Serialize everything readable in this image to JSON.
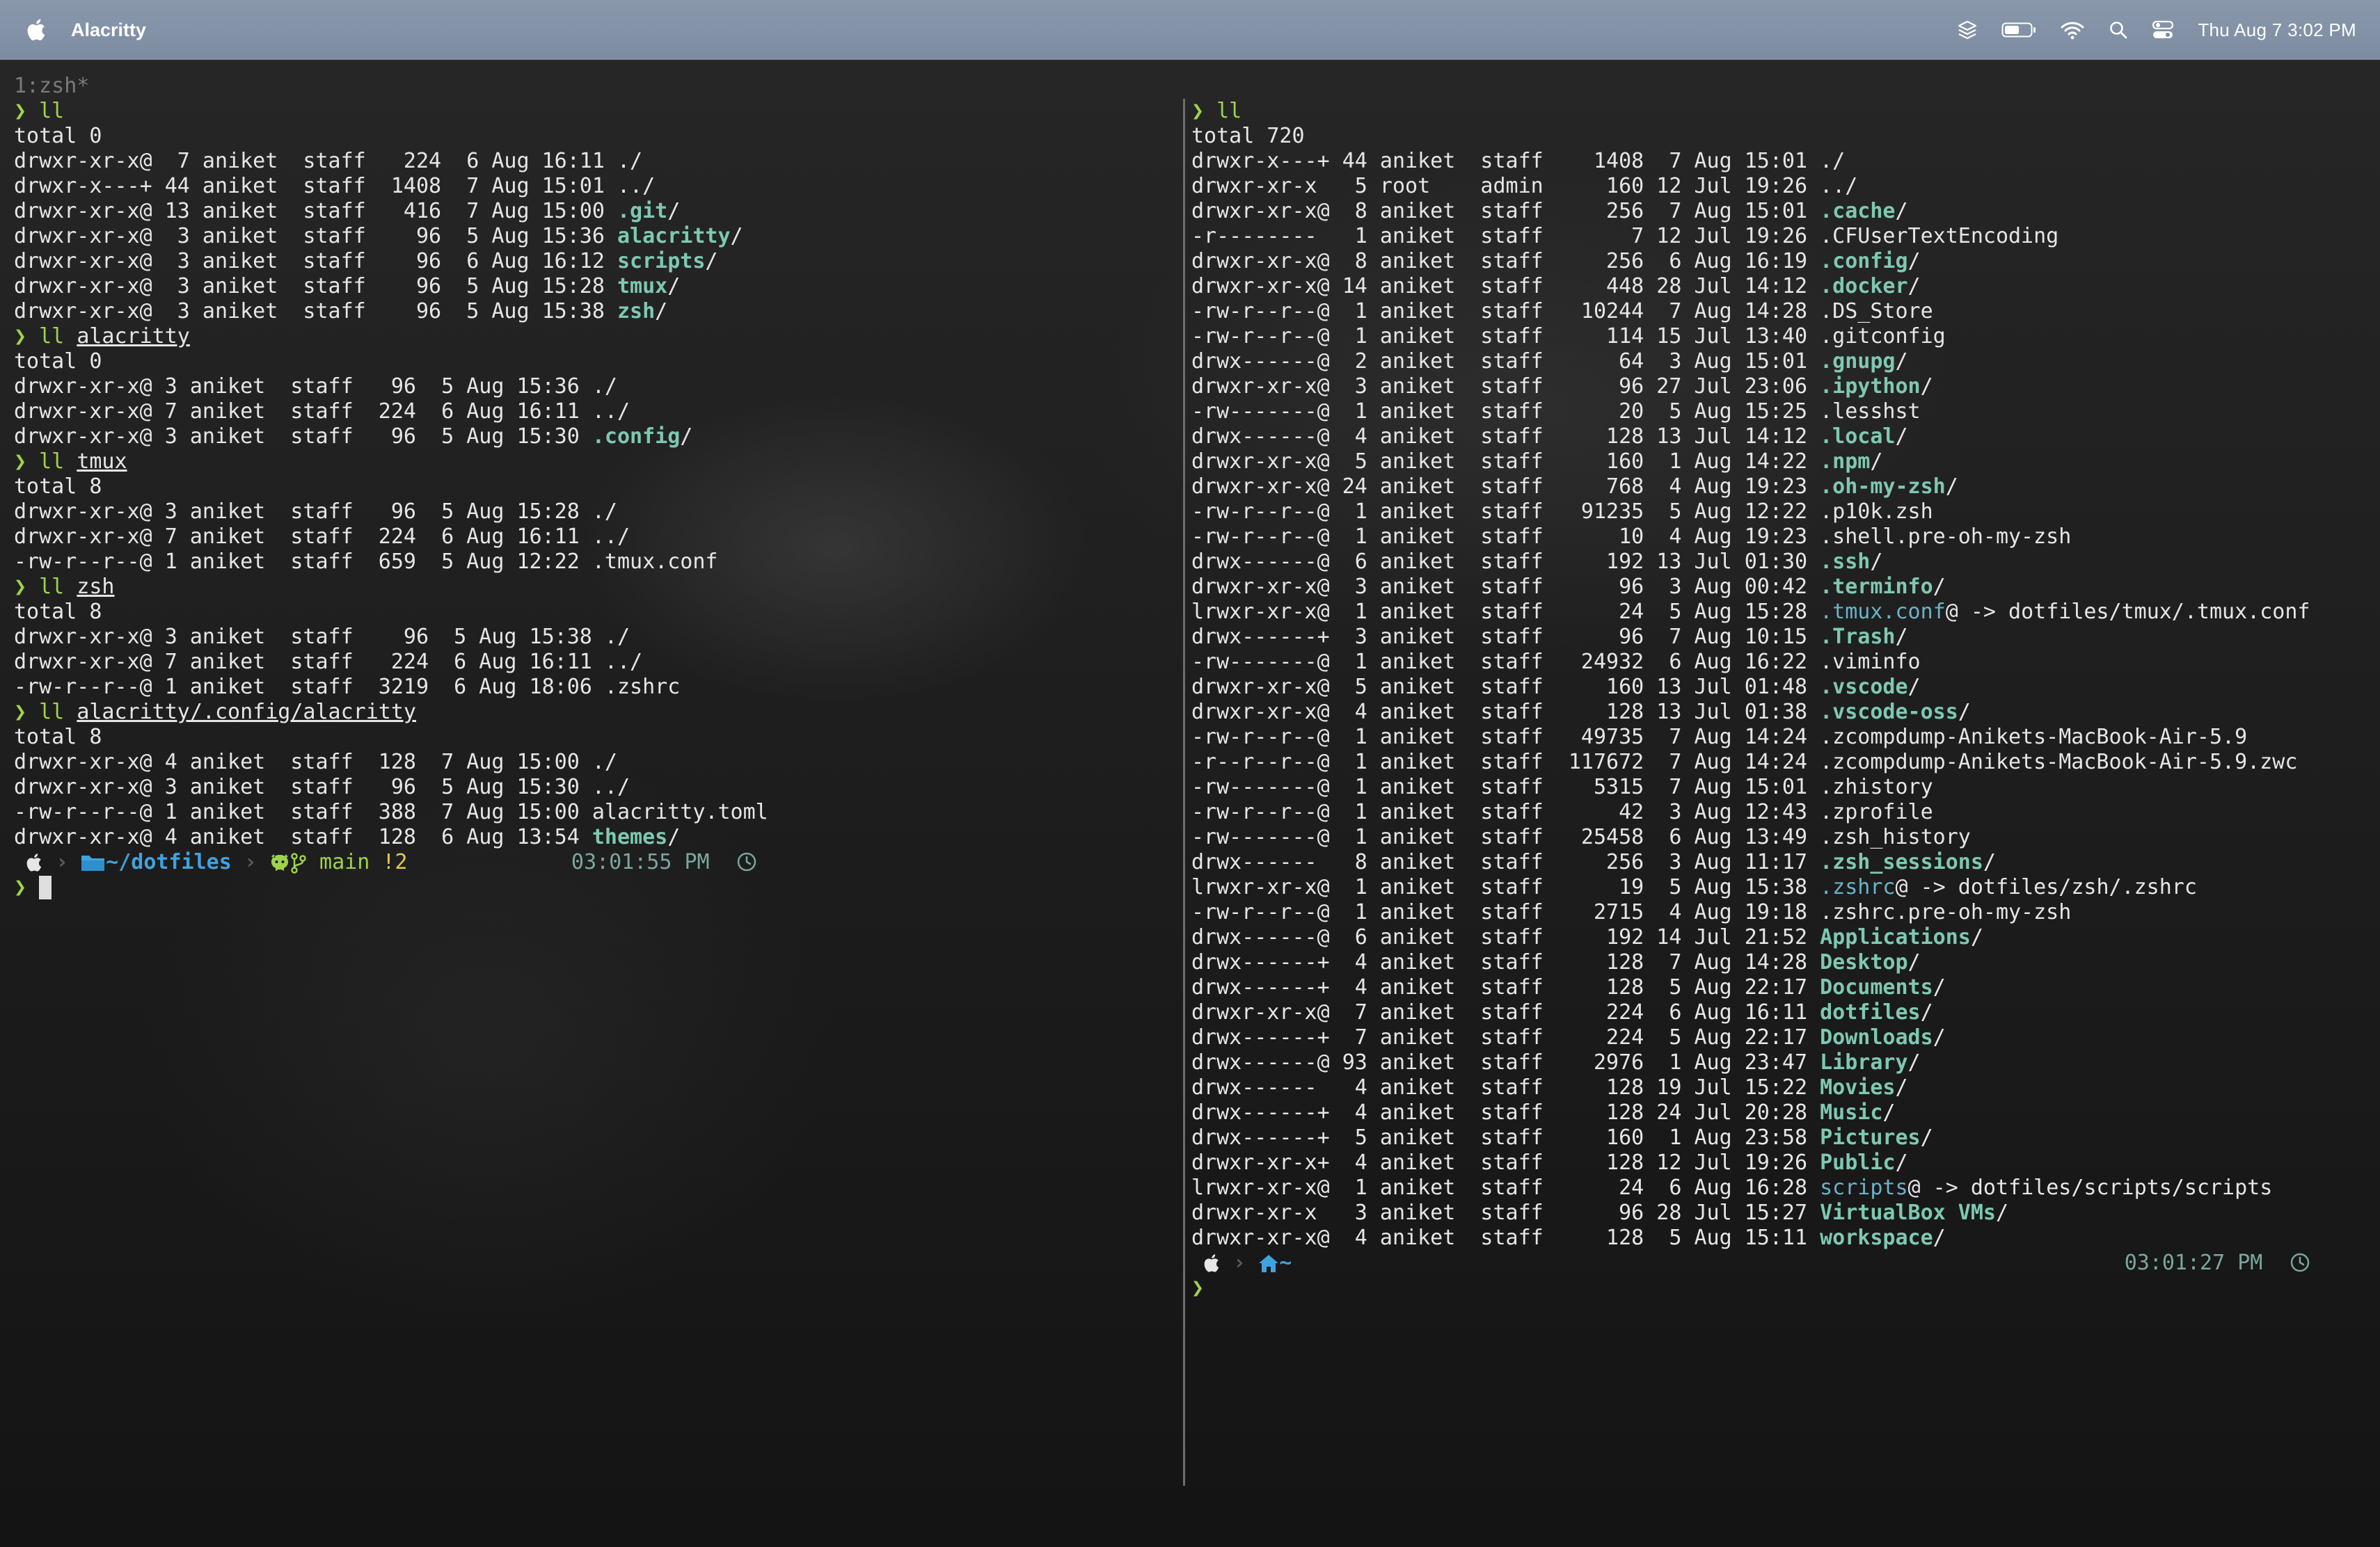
{
  "menubar": {
    "app_name": "Alacritty",
    "datetime": "Thu Aug 7  3:02 PM"
  },
  "left_pane": {
    "title": "1:zsh*",
    "lines": [
      [
        {
          "t": "❯ ",
          "c": "pr"
        },
        {
          "t": "ll",
          "c": "pr"
        }
      ],
      [
        {
          "t": "total 0"
        }
      ],
      [
        {
          "t": "drwxr-xr-x@  7 aniket  staff   224  6 Aug 16:11 ./"
        }
      ],
      [
        {
          "t": "drwxr-x---+ 44 aniket  staff  1408  7 Aug 15:01 ../"
        }
      ],
      [
        {
          "t": "drwxr-xr-x@ 13 aniket  staff   416  7 Aug 15:00 "
        },
        {
          "t": ".git",
          "c": "dir"
        },
        {
          "t": "/"
        }
      ],
      [
        {
          "t": "drwxr-xr-x@  3 aniket  staff    96  5 Aug 15:36 "
        },
        {
          "t": "alacritty",
          "c": "dir"
        },
        {
          "t": "/"
        }
      ],
      [
        {
          "t": "drwxr-xr-x@  3 aniket  staff    96  6 Aug 16:12 "
        },
        {
          "t": "scripts",
          "c": "dir"
        },
        {
          "t": "/"
        }
      ],
      [
        {
          "t": "drwxr-xr-x@  3 aniket  staff    96  5 Aug 15:28 "
        },
        {
          "t": "tmux",
          "c": "dir"
        },
        {
          "t": "/"
        }
      ],
      [
        {
          "t": "drwxr-xr-x@  3 aniket  staff    96  5 Aug 15:38 "
        },
        {
          "t": "zsh",
          "c": "dir"
        },
        {
          "t": "/"
        }
      ],
      [
        {
          "t": "❯ ",
          "c": "pr"
        },
        {
          "t": "ll ",
          "c": "pr"
        },
        {
          "t": "alacritty",
          "c": "u"
        }
      ],
      [
        {
          "t": "total 0"
        }
      ],
      [
        {
          "t": "drwxr-xr-x@ 3 aniket  staff   96  5 Aug 15:36 ./"
        }
      ],
      [
        {
          "t": "drwxr-xr-x@ 7 aniket  staff  224  6 Aug 16:11 ../"
        }
      ],
      [
        {
          "t": "drwxr-xr-x@ 3 aniket  staff   96  5 Aug 15:30 "
        },
        {
          "t": ".config",
          "c": "dir"
        },
        {
          "t": "/"
        }
      ],
      [
        {
          "t": "❯ ",
          "c": "pr"
        },
        {
          "t": "ll ",
          "c": "pr"
        },
        {
          "t": "tmux",
          "c": "u"
        }
      ],
      [
        {
          "t": "total 8"
        }
      ],
      [
        {
          "t": "drwxr-xr-x@ 3 aniket  staff   96  5 Aug 15:28 ./"
        }
      ],
      [
        {
          "t": "drwxr-xr-x@ 7 aniket  staff  224  6 Aug 16:11 ../"
        }
      ],
      [
        {
          "t": "-rw-r--r--@ 1 aniket  staff  659  5 Aug 12:22 .tmux.conf"
        }
      ],
      [
        {
          "t": "❯ ",
          "c": "pr"
        },
        {
          "t": "ll ",
          "c": "pr"
        },
        {
          "t": "zsh",
          "c": "u"
        }
      ],
      [
        {
          "t": "total 8"
        }
      ],
      [
        {
          "t": "drwxr-xr-x@ 3 aniket  staff    96  5 Aug 15:38 ./"
        }
      ],
      [
        {
          "t": "drwxr-xr-x@ 7 aniket  staff   224  6 Aug 16:11 ../"
        }
      ],
      [
        {
          "t": "-rw-r--r--@ 1 aniket  staff  3219  6 Aug 18:06 .zshrc"
        }
      ],
      [
        {
          "t": "❯ ",
          "c": "pr"
        },
        {
          "t": "ll ",
          "c": "pr"
        },
        {
          "t": "alacritty/.config/alacritty",
          "c": "u"
        }
      ],
      [
        {
          "t": "total 8"
        }
      ],
      [
        {
          "t": "drwxr-xr-x@ 4 aniket  staff  128  7 Aug 15:00 ./"
        }
      ],
      [
        {
          "t": "drwxr-xr-x@ 3 aniket  staff   96  5 Aug 15:30 ../"
        }
      ],
      [
        {
          "t": "-rw-r--r--@ 1 aniket  staff  388  7 Aug 15:00 alacritty.toml"
        }
      ],
      [
        {
          "t": "drwxr-xr-x@ 4 aniket  staff  128  6 Aug 13:54 "
        },
        {
          "t": "themes",
          "c": "dir"
        },
        {
          "t": "/"
        }
      ]
    ],
    "prompt": {
      "path": "~/dotfiles",
      "git_branch": "main",
      "git_status": "!2",
      "time": "03:01:55 PM"
    },
    "input_prompt": "❯"
  },
  "right_pane": {
    "lines": [
      [
        {
          "t": "❯ ",
          "c": "pr"
        },
        {
          "t": "ll",
          "c": "pr"
        }
      ],
      [
        {
          "t": "total 720"
        }
      ],
      [
        {
          "t": "drwxr-x---+ 44 aniket  staff    1408  7 Aug 15:01 ./"
        }
      ],
      [
        {
          "t": "drwxr-xr-x   5 root    admin     160 12 Jul 19:26 ../"
        }
      ],
      [
        {
          "t": "drwxr-xr-x@  8 aniket  staff     256  7 Aug 15:01 "
        },
        {
          "t": ".cache",
          "c": "dir"
        },
        {
          "t": "/"
        }
      ],
      [
        {
          "t": "-r--------   1 aniket  staff       7 12 Jul 19:26 .CFUserTextEncoding"
        }
      ],
      [
        {
          "t": "drwxr-xr-x@  8 aniket  staff     256  6 Aug 16:19 "
        },
        {
          "t": ".config",
          "c": "dir"
        },
        {
          "t": "/"
        }
      ],
      [
        {
          "t": "drwxr-xr-x@ 14 aniket  staff     448 28 Jul 14:12 "
        },
        {
          "t": ".docker",
          "c": "dir"
        },
        {
          "t": "/"
        }
      ],
      [
        {
          "t": "-rw-r--r--@  1 aniket  staff   10244  7 Aug 14:28 .DS_Store"
        }
      ],
      [
        {
          "t": "-rw-r--r--@  1 aniket  staff     114 15 Jul 13:40 .gitconfig"
        }
      ],
      [
        {
          "t": "drwx------@  2 aniket  staff      64  3 Aug 15:01 "
        },
        {
          "t": ".gnupg",
          "c": "dir"
        },
        {
          "t": "/"
        }
      ],
      [
        {
          "t": "drwxr-xr-x@  3 aniket  staff      96 27 Jul 23:06 "
        },
        {
          "t": ".ipython",
          "c": "dir"
        },
        {
          "t": "/"
        }
      ],
      [
        {
          "t": "-rw-------@  1 aniket  staff      20  5 Aug 15:25 .lesshst"
        }
      ],
      [
        {
          "t": "drwx------@  4 aniket  staff     128 13 Jul 14:12 "
        },
        {
          "t": ".local",
          "c": "dir"
        },
        {
          "t": "/"
        }
      ],
      [
        {
          "t": "drwxr-xr-x@  5 aniket  staff     160  1 Aug 14:22 "
        },
        {
          "t": ".npm",
          "c": "dir"
        },
        {
          "t": "/"
        }
      ],
      [
        {
          "t": "drwxr-xr-x@ 24 aniket  staff     768  4 Aug 19:23 "
        },
        {
          "t": ".oh-my-zsh",
          "c": "dir"
        },
        {
          "t": "/"
        }
      ],
      [
        {
          "t": "-rw-r--r--@  1 aniket  staff   91235  5 Aug 12:22 .p10k.zsh"
        }
      ],
      [
        {
          "t": "-rw-r--r--@  1 aniket  staff      10  4 Aug 19:23 .shell.pre-oh-my-zsh"
        }
      ],
      [
        {
          "t": "drwx------@  6 aniket  staff     192 13 Jul 01:30 "
        },
        {
          "t": ".ssh",
          "c": "dir"
        },
        {
          "t": "/"
        }
      ],
      [
        {
          "t": "drwxr-xr-x@  3 aniket  staff      96  3 Aug 00:42 "
        },
        {
          "t": ".terminfo",
          "c": "dir"
        },
        {
          "t": "/"
        }
      ],
      [
        {
          "t": "lrwxr-xr-x@  1 aniket  staff      24  5 Aug 15:28 "
        },
        {
          "t": ".tmux.conf",
          "c": "link"
        },
        {
          "t": "@ -> dotfiles/tmux/.tmux.conf"
        }
      ],
      [
        {
          "t": "drwx------+  3 aniket  staff      96  7 Aug 10:15 "
        },
        {
          "t": ".Trash",
          "c": "dir"
        },
        {
          "t": "/"
        }
      ],
      [
        {
          "t": "-rw-------@  1 aniket  staff   24932  6 Aug 16:22 .viminfo"
        }
      ],
      [
        {
          "t": "drwxr-xr-x@  5 aniket  staff     160 13 Jul 01:48 "
        },
        {
          "t": ".vscode",
          "c": "dir"
        },
        {
          "t": "/"
        }
      ],
      [
        {
          "t": "drwxr-xr-x@  4 aniket  staff     128 13 Jul 01:38 "
        },
        {
          "t": ".vscode-oss",
          "c": "dir"
        },
        {
          "t": "/"
        }
      ],
      [
        {
          "t": "-rw-r--r--@  1 aniket  staff   49735  7 Aug 14:24 .zcompdump-Anikets-MacBook-Air-5.9"
        }
      ],
      [
        {
          "t": "-r--r--r--@  1 aniket  staff  117672  7 Aug 14:24 .zcompdump-Anikets-MacBook-Air-5.9.zwc"
        }
      ],
      [
        {
          "t": "-rw-------@  1 aniket  staff    5315  7 Aug 15:01 .zhistory"
        }
      ],
      [
        {
          "t": "-rw-r--r--@  1 aniket  staff      42  3 Aug 12:43 .zprofile"
        }
      ],
      [
        {
          "t": "-rw-------@  1 aniket  staff   25458  6 Aug 13:49 .zsh_history"
        }
      ],
      [
        {
          "t": "drwx------   8 aniket  staff     256  3 Aug 11:17 "
        },
        {
          "t": ".zsh_sessions",
          "c": "dir"
        },
        {
          "t": "/"
        }
      ],
      [
        {
          "t": "lrwxr-xr-x@  1 aniket  staff      19  5 Aug 15:38 "
        },
        {
          "t": ".zshrc",
          "c": "link"
        },
        {
          "t": "@ -> dotfiles/zsh/.zshrc"
        }
      ],
      [
        {
          "t": "-rw-r--r--@  1 aniket  staff    2715  4 Aug 19:18 .zshrc.pre-oh-my-zsh"
        }
      ],
      [
        {
          "t": "drwx------@  6 aniket  staff     192 14 Jul 21:52 "
        },
        {
          "t": "Applications",
          "c": "dir"
        },
        {
          "t": "/"
        }
      ],
      [
        {
          "t": "drwx------+  4 aniket  staff     128  7 Aug 14:28 "
        },
        {
          "t": "Desktop",
          "c": "dir"
        },
        {
          "t": "/"
        }
      ],
      [
        {
          "t": "drwx------+  4 aniket  staff     128  5 Aug 22:17 "
        },
        {
          "t": "Documents",
          "c": "dir"
        },
        {
          "t": "/"
        }
      ],
      [
        {
          "t": "drwxr-xr-x@  7 aniket  staff     224  6 Aug 16:11 "
        },
        {
          "t": "dotfiles",
          "c": "dir"
        },
        {
          "t": "/"
        }
      ],
      [
        {
          "t": "drwx------+  7 aniket  staff     224  5 Aug 22:17 "
        },
        {
          "t": "Downloads",
          "c": "dir"
        },
        {
          "t": "/"
        }
      ],
      [
        {
          "t": "drwx------@ 93 aniket  staff    2976  1 Aug 23:47 "
        },
        {
          "t": "Library",
          "c": "dir"
        },
        {
          "t": "/"
        }
      ],
      [
        {
          "t": "drwx------   4 aniket  staff     128 19 Jul 15:22 "
        },
        {
          "t": "Movies",
          "c": "dir"
        },
        {
          "t": "/"
        }
      ],
      [
        {
          "t": "drwx------+  4 aniket  staff     128 24 Jul 20:28 "
        },
        {
          "t": "Music",
          "c": "dir"
        },
        {
          "t": "/"
        }
      ],
      [
        {
          "t": "drwx------+  5 aniket  staff     160  1 Aug 23:58 "
        },
        {
          "t": "Pictures",
          "c": "dir"
        },
        {
          "t": "/"
        }
      ],
      [
        {
          "t": "drwxr-xr-x+  4 aniket  staff     128 12 Jul 19:26 "
        },
        {
          "t": "Public",
          "c": "dir"
        },
        {
          "t": "/"
        }
      ],
      [
        {
          "t": "lrwxr-xr-x@  1 aniket  staff      24  6 Aug 16:28 "
        },
        {
          "t": "scripts",
          "c": "link"
        },
        {
          "t": "@ -> dotfiles/scripts/scripts"
        }
      ],
      [
        {
          "t": "drwxr-xr-x   3 aniket  staff      96 28 Jul 15:27 "
        },
        {
          "t": "VirtualBox VMs",
          "c": "dir"
        },
        {
          "t": "/"
        }
      ],
      [
        {
          "t": "drwxr-xr-x@  4 aniket  staff     128  5 Aug 15:11 "
        },
        {
          "t": "workspace",
          "c": "dir"
        },
        {
          "t": "/"
        }
      ]
    ],
    "prompt": {
      "path": "~",
      "time": "03:01:27 PM"
    },
    "input_prompt": "❯"
  },
  "colors": {
    "prompt_green": "#9fd34a",
    "directory": "#7ec8b3",
    "symlink": "#6ab3c9",
    "path_blue": "#3ea3e0",
    "git_status_yellow": "#e5c84a",
    "time_teal": "#7aa6a0"
  },
  "icons": [
    "apple-icon",
    "dropbox-icon",
    "battery-icon",
    "wifi-icon",
    "search-icon",
    "control-center-icon",
    "folder-icon",
    "home-icon",
    "git-branch-icon",
    "github-icon",
    "clock-icon"
  ]
}
